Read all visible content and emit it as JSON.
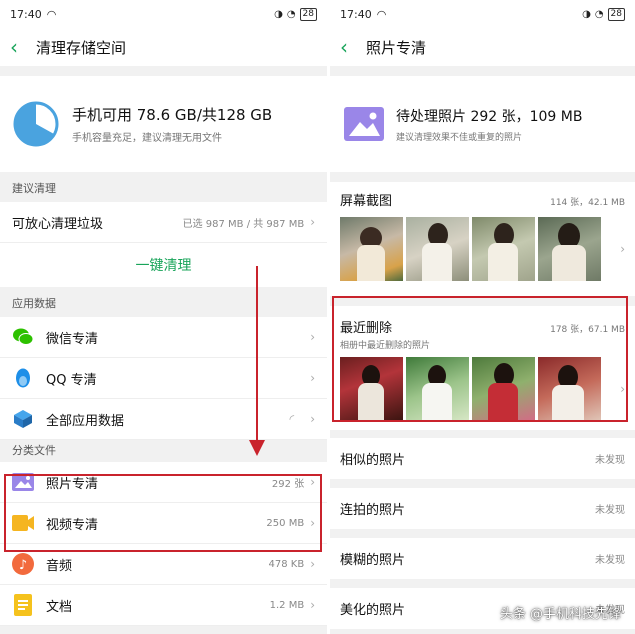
{
  "left": {
    "status": {
      "time": "17:40",
      "battery": "28"
    },
    "title": "清理存储空间",
    "storage": {
      "main": "手机可用 78.6 GB/共128 GB",
      "sub": "手机容量充足，建议清理无用文件"
    },
    "suggest": {
      "section": "建议清理",
      "row_label": "可放心清理垃圾",
      "row_value": "已选 987 MB / 共 987 MB",
      "button": "一键清理"
    },
    "app_data": {
      "section": "应用数据",
      "items": [
        {
          "label": "微信专清",
          "value": "",
          "icon": "wechat-icon"
        },
        {
          "label": "QQ 专清",
          "value": "",
          "icon": "qq-penguin-icon"
        },
        {
          "label": "全部应用数据",
          "value": "",
          "icon": "apps-cube-icon"
        }
      ]
    },
    "files": {
      "section": "分类文件",
      "items": [
        {
          "label": "照片专清",
          "value": "292 张",
          "icon": "photo-icon"
        },
        {
          "label": "视频专清",
          "value": "250 MB",
          "icon": "video-icon"
        },
        {
          "label": "音频",
          "value": "478 KB",
          "icon": "music-icon"
        },
        {
          "label": "文档",
          "value": "1.2 MB",
          "icon": "document-icon"
        }
      ]
    }
  },
  "right": {
    "status": {
      "time": "17:40",
      "battery": "28"
    },
    "title": "照片专清",
    "pending": {
      "main": "待处理照片 292 张，109 MB",
      "sub": "建议清理效果不佳或重复的照片"
    },
    "screenshots": {
      "title": "屏幕截图",
      "meta": "114 张，42.1 MB"
    },
    "recent": {
      "title": "最近删除",
      "sub": "相册中最近删除的照片",
      "meta": "178 张，67.1 MB"
    },
    "rows": [
      {
        "label": "相似的照片",
        "value": "未发现"
      },
      {
        "label": "连拍的照片",
        "value": "未发现"
      },
      {
        "label": "模糊的照片",
        "value": "未发现"
      },
      {
        "label": "美化的照片",
        "value": "未发现"
      }
    ]
  },
  "watermark": "头条 @手机科技先锋",
  "colors": {
    "accent": "#19a45a",
    "highlight": "#c9232c",
    "pie": "#4aa3df"
  }
}
